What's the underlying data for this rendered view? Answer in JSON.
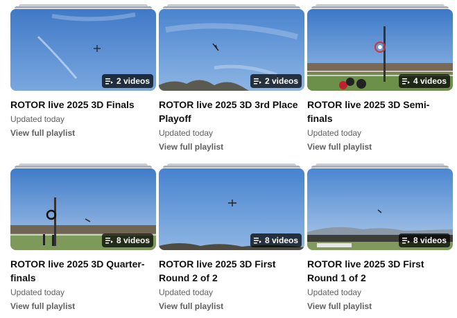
{
  "playlists": [
    {
      "title": "ROTOR live 2025 3D Finals",
      "count": "2 videos",
      "updated": "Updated today",
      "view": "View full playlist"
    },
    {
      "title": "ROTOR live 2025 3D 3rd Place Playoff",
      "count": "2 videos",
      "updated": "Updated today",
      "view": "View full playlist"
    },
    {
      "title": "ROTOR live 2025 3D Semi-finals",
      "count": "4 videos",
      "updated": "Updated today",
      "view": "View full playlist"
    },
    {
      "title": "ROTOR live 2025 3D Quarter-finals",
      "count": "8 videos",
      "updated": "Updated today",
      "view": "View full playlist"
    },
    {
      "title": "ROTOR live 2025 3D First Round 2 of 2",
      "count": "8 videos",
      "updated": "Updated today",
      "view": "View full playlist"
    },
    {
      "title": "ROTOR live 2025 3D First Round 1 of 2",
      "count": "8 videos",
      "updated": "Updated today",
      "view": "View full playlist"
    }
  ],
  "icons": {
    "badge": "playlist-icon"
  },
  "colors": {
    "sky": "#5b8fd0",
    "text": "#0f0f0f",
    "secondary": "#606060"
  }
}
